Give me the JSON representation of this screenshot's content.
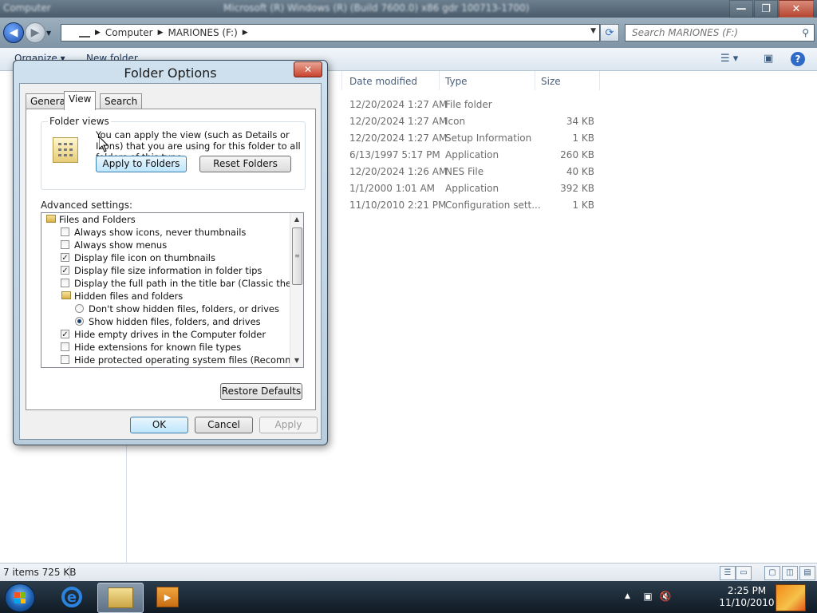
{
  "window": {
    "title": "Microsoft (R) Windows (R) (Build 7600.0) x86 gdr 100713-1700)",
    "left_title": "Computer",
    "buttons": {
      "minimize": "—",
      "maximize": "❐",
      "close": "✕"
    }
  },
  "address": {
    "crumbs": [
      "Computer",
      "MARIONES (F:)"
    ],
    "search_placeholder": "Search MARIONES (F:)"
  },
  "commandbar": {
    "organize": "Organize ▾",
    "new_folder": "New folder"
  },
  "columns": {
    "date": "Date modified",
    "type": "Type",
    "size": "Size"
  },
  "files": [
    {
      "date": "12/20/2024 1:27 AM",
      "type": "File folder",
      "size": ""
    },
    {
      "date": "12/20/2024 1:27 AM",
      "type": "Icon",
      "size": "34 KB"
    },
    {
      "date": "12/20/2024 1:27 AM",
      "type": "Setup Information",
      "size": "1 KB"
    },
    {
      "date": "6/13/1997 5:17 PM",
      "type": "Application",
      "size": "260 KB"
    },
    {
      "date": "12/20/2024 1:26 AM",
      "type": "NES File",
      "size": "40 KB"
    },
    {
      "date": "1/1/2000 1:01 AM",
      "type": "Application",
      "size": "392 KB"
    },
    {
      "date": "11/10/2010 2:21 PM",
      "type": "Configuration sett...",
      "size": "1 KB"
    }
  ],
  "status": {
    "text": "7 items  725 KB"
  },
  "taskbar": {
    "time": "2:25 PM",
    "date": "11/10/2010"
  },
  "dialog": {
    "title": "Folder Options",
    "close_label": "✕",
    "tabs": [
      "General",
      "View",
      "Search"
    ],
    "active_tab": "View",
    "folder_views": {
      "legend": "Folder views",
      "description": "You can apply the view (such as Details or Icons) that you are using for this folder to all folders of this type.",
      "apply_label": "Apply to Folders",
      "reset_label": "Reset Folders"
    },
    "advanced_label": "Advanced settings:",
    "advanced_items": [
      {
        "kind": "folder",
        "label": "Files and Folders"
      },
      {
        "kind": "check",
        "checked": false,
        "label": "Always show icons, never thumbnails"
      },
      {
        "kind": "check",
        "checked": false,
        "label": "Always show menus"
      },
      {
        "kind": "check",
        "checked": true,
        "label": "Display file icon on thumbnails"
      },
      {
        "kind": "check",
        "checked": true,
        "label": "Display file size information in folder tips"
      },
      {
        "kind": "check",
        "checked": false,
        "label": "Display the full path in the title bar (Classic theme only)"
      },
      {
        "kind": "subfolder",
        "label": "Hidden files and folders"
      },
      {
        "kind": "radio",
        "checked": false,
        "label": "Don't show hidden files, folders, or drives"
      },
      {
        "kind": "radio",
        "checked": true,
        "label": "Show hidden files, folders, and drives"
      },
      {
        "kind": "check",
        "checked": true,
        "label": "Hide empty drives in the Computer folder"
      },
      {
        "kind": "check",
        "checked": false,
        "label": "Hide extensions for known file types"
      },
      {
        "kind": "check",
        "checked": false,
        "label": "Hide protected operating system files (Recommended)"
      }
    ],
    "restore_label": "Restore Defaults",
    "ok_label": "OK",
    "cancel_label": "Cancel",
    "apply_label": "Apply"
  }
}
